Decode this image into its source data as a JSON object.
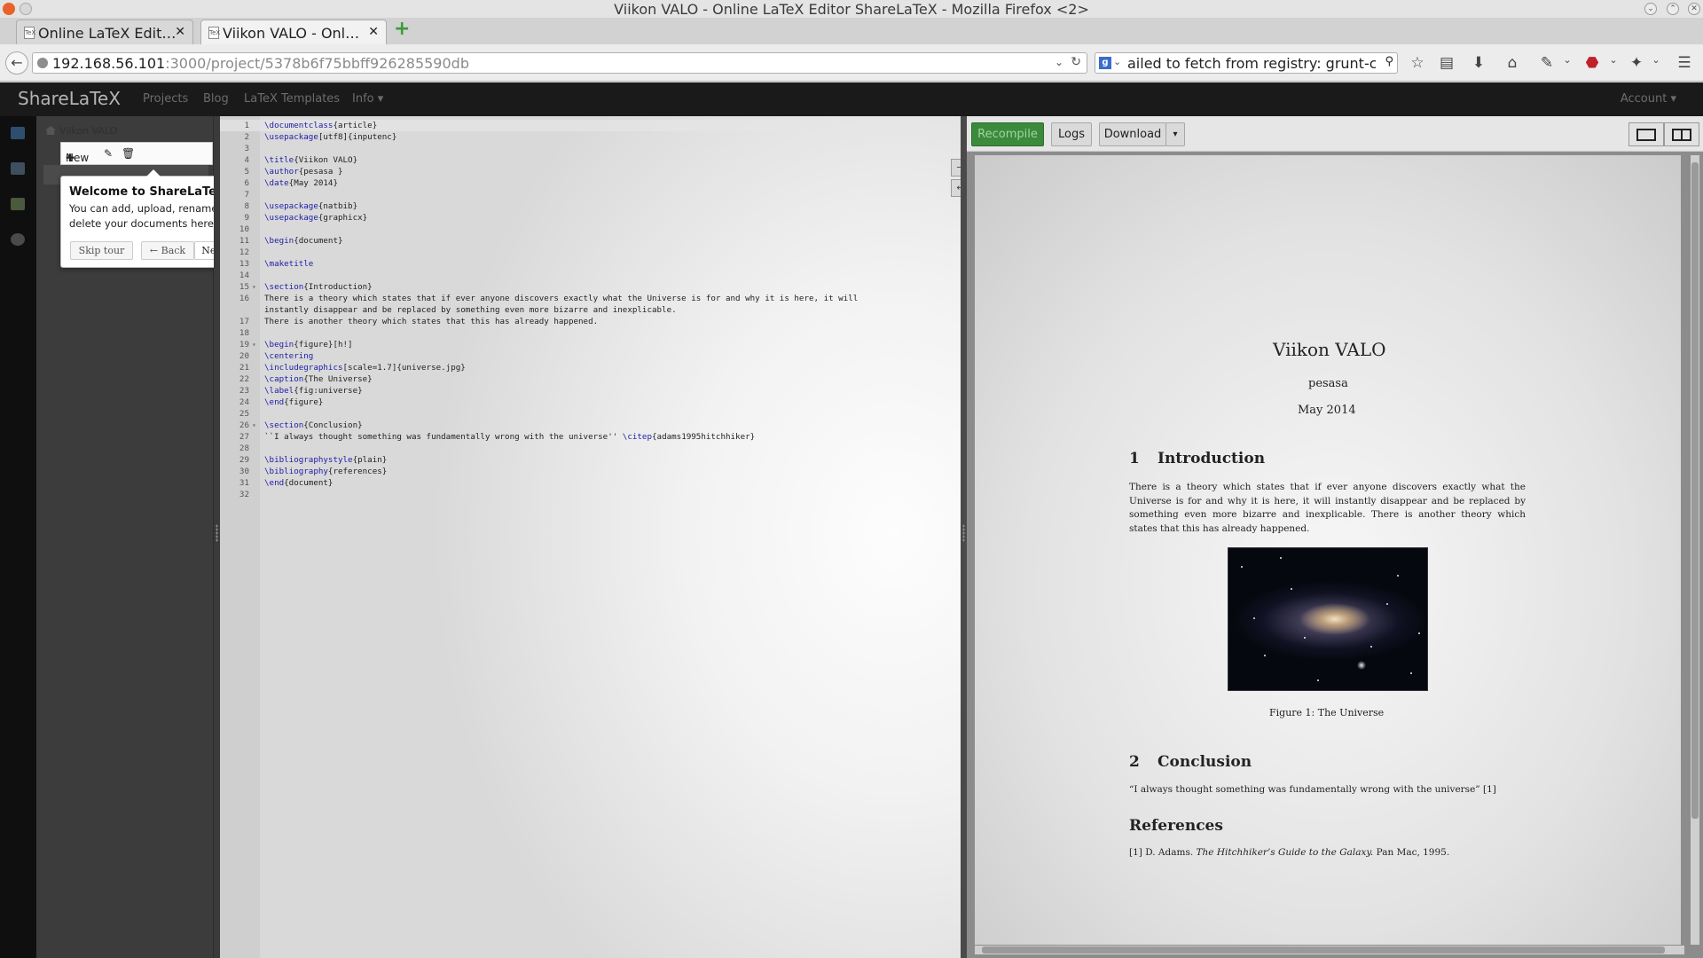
{
  "window": {
    "title": "Viikon VALO - Online LaTeX Editor ShareLaTeX - Mozilla Firefox <2>"
  },
  "browser": {
    "tabs": [
      {
        "label": "Online LaTeX Edit…",
        "favicon": "page-icon",
        "active": false
      },
      {
        "label": "Viikon VALO - Onl…",
        "favicon": "page-icon",
        "active": true
      }
    ],
    "url_host": "192.168.56.101",
    "url_path": ":3000/project/5378b6f75bbff926285590db",
    "search_value": "ailed to fetch from registry: grunt-cli",
    "toolbar_icons": [
      "bookmark-star-icon",
      "bookmarks-list-icon",
      "download-icon",
      "home-icon",
      "tools-icon",
      "adblock-icon",
      "extension-icon",
      "menu-icon"
    ]
  },
  "app": {
    "brand": "ShareLaTeX",
    "nav": [
      "Projects",
      "Blog",
      "LaTeX Templates",
      "Info"
    ],
    "account": "Account"
  },
  "filetree": {
    "project_name": "Viikon VALO",
    "new_label": "New"
  },
  "tour": {
    "title": "Welcome to ShareLaTeX!",
    "body": "You can add, upload, rename and delete your documents here.",
    "skip": "Skip tour",
    "back": "← Back",
    "next": "Next →"
  },
  "editor": {
    "lines": [
      {
        "n": "1",
        "fold": "",
        "parts": [
          [
            "kw",
            "\\documentclass"
          ],
          [
            "",
            "{article}"
          ]
        ]
      },
      {
        "n": "2",
        "fold": "",
        "parts": [
          [
            "kw",
            "\\usepackage"
          ],
          [
            "",
            "[utf8]{inputenc}"
          ]
        ]
      },
      {
        "n": "3",
        "fold": "",
        "parts": []
      },
      {
        "n": "4",
        "fold": "",
        "parts": [
          [
            "kw",
            "\\title"
          ],
          [
            "",
            "{Viikon VALO}"
          ]
        ]
      },
      {
        "n": "5",
        "fold": "",
        "parts": [
          [
            "kw",
            "\\author"
          ],
          [
            "",
            "{pesasa }"
          ]
        ]
      },
      {
        "n": "6",
        "fold": "",
        "parts": [
          [
            "kw",
            "\\date"
          ],
          [
            "",
            "{May 2014}"
          ]
        ]
      },
      {
        "n": "7",
        "fold": "",
        "parts": []
      },
      {
        "n": "8",
        "fold": "",
        "parts": [
          [
            "kw",
            "\\usepackage"
          ],
          [
            "",
            "{natbib}"
          ]
        ]
      },
      {
        "n": "9",
        "fold": "",
        "parts": [
          [
            "kw",
            "\\usepackage"
          ],
          [
            "",
            "{graphicx}"
          ]
        ]
      },
      {
        "n": "10",
        "fold": "",
        "parts": []
      },
      {
        "n": "11",
        "fold": "",
        "parts": [
          [
            "kw",
            "\\begin"
          ],
          [
            "",
            "{document}"
          ]
        ]
      },
      {
        "n": "12",
        "fold": "",
        "parts": []
      },
      {
        "n": "13",
        "fold": "",
        "parts": [
          [
            "kw",
            "\\maketitle"
          ]
        ]
      },
      {
        "n": "14",
        "fold": "",
        "parts": []
      },
      {
        "n": "15",
        "fold": "▾",
        "parts": [
          [
            "kw",
            "\\section"
          ],
          [
            "",
            "{Introduction}"
          ]
        ]
      },
      {
        "n": "16",
        "fold": "",
        "parts": [
          [
            "",
            "There is a theory which states that if ever anyone discovers exactly what the Universe is for and why it is here, it will"
          ]
        ]
      },
      {
        "n": "",
        "fold": "",
        "parts": [
          [
            "",
            "instantly disappear and be replaced by something even more bizarre and inexplicable."
          ]
        ]
      },
      {
        "n": "17",
        "fold": "",
        "parts": [
          [
            "",
            "There is another theory which states that this has already happened."
          ]
        ]
      },
      {
        "n": "18",
        "fold": "",
        "parts": []
      },
      {
        "n": "19",
        "fold": "▾",
        "parts": [
          [
            "kw",
            "\\begin"
          ],
          [
            "",
            "{figure}[h!]"
          ]
        ]
      },
      {
        "n": "20",
        "fold": "",
        "parts": [
          [
            "kw",
            "\\centering"
          ]
        ]
      },
      {
        "n": "21",
        "fold": "",
        "parts": [
          [
            "kw",
            "\\includegraphics"
          ],
          [
            "",
            "[scale=1.7]{universe.jpg}"
          ]
        ]
      },
      {
        "n": "22",
        "fold": "",
        "parts": [
          [
            "kw",
            "\\caption"
          ],
          [
            "",
            "{The Universe}"
          ]
        ]
      },
      {
        "n": "23",
        "fold": "",
        "parts": [
          [
            "kw",
            "\\label"
          ],
          [
            "",
            "{fig:universe}"
          ]
        ]
      },
      {
        "n": "24",
        "fold": "",
        "parts": [
          [
            "kw",
            "\\end"
          ],
          [
            "",
            "{figure}"
          ]
        ]
      },
      {
        "n": "25",
        "fold": "",
        "parts": []
      },
      {
        "n": "26",
        "fold": "▾",
        "parts": [
          [
            "kw",
            "\\section"
          ],
          [
            "",
            "{Conclusion}"
          ]
        ]
      },
      {
        "n": "27",
        "fold": "",
        "parts": [
          [
            "",
            "``I always thought something was fundamentally wrong with the universe'' "
          ],
          [
            "kw",
            "\\citep"
          ],
          [
            "",
            "{adams1995hitchhiker}"
          ]
        ]
      },
      {
        "n": "28",
        "fold": "",
        "parts": []
      },
      {
        "n": "29",
        "fold": "",
        "parts": [
          [
            "kw",
            "\\bibliographystyle"
          ],
          [
            "",
            "{plain}"
          ]
        ]
      },
      {
        "n": "30",
        "fold": "",
        "parts": [
          [
            "kw",
            "\\bibliography"
          ],
          [
            "",
            "{references}"
          ]
        ]
      },
      {
        "n": "31",
        "fold": "",
        "parts": [
          [
            "kw",
            "\\end"
          ],
          [
            "",
            "{document}"
          ]
        ]
      },
      {
        "n": "32",
        "fold": "",
        "parts": []
      }
    ]
  },
  "pdf": {
    "recompile": "Recompile",
    "logs": "Logs",
    "download": "Download",
    "doc_title": "Viikon VALO",
    "author": "pesasa",
    "date": "May 2014",
    "sec1_num": "1",
    "sec1_title": "Introduction",
    "sec1_body": "There is a theory which states that if ever anyone discovers exactly what the Universe is for and why it is here, it will instantly disappear and be replaced by something even more bizarre and inexplicable. There is another theory which states that this has already happened.",
    "figure_caption": "Figure 1: The Universe",
    "sec2_num": "2",
    "sec2_title": "Conclusion",
    "sec2_body": "“I always thought something was fundamentally wrong with the universe” [1]",
    "refs_title": "References",
    "ref1_pre": "[1]  D. Adams.",
    "ref1_title": "The Hitchhiker’s Guide to the Galaxy.",
    "ref1_post": "Pan Mac, 1995."
  },
  "colors": {
    "recompile_green": "#3c8a3c",
    "header_bg": "#1a1a1a",
    "latex_keyword": "#2020a8"
  }
}
